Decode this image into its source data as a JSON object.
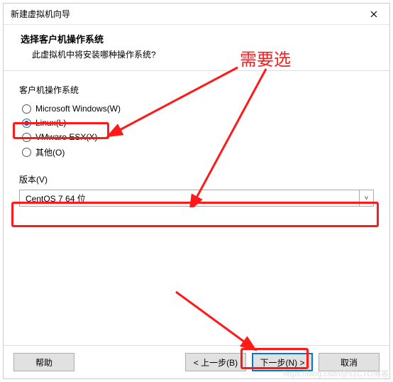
{
  "window": {
    "title": "新建虚拟机向导"
  },
  "header": {
    "title": "选择客户机操作系统",
    "subtitle": "此虚拟机中将安装哪种操作系统?"
  },
  "os_group": {
    "label": "客户机操作系统",
    "options": {
      "win": {
        "label": "Microsoft Windows(W)",
        "checked": false
      },
      "linux": {
        "label": "Linux(L)",
        "checked": true
      },
      "esx": {
        "label": "VMware ESX(X)",
        "checked": false
      },
      "other": {
        "label": "其他(O)",
        "checked": false
      }
    }
  },
  "version": {
    "label": "版本(V)",
    "value": "CentOS 7 64 位"
  },
  "buttons": {
    "help": "帮助",
    "back": "< 上一步(B)",
    "next": "下一步(N) >",
    "cancel": "取消"
  },
  "annotation": {
    "text": "需要选"
  },
  "watermark": "https://blog.csdn@51CTO博客"
}
